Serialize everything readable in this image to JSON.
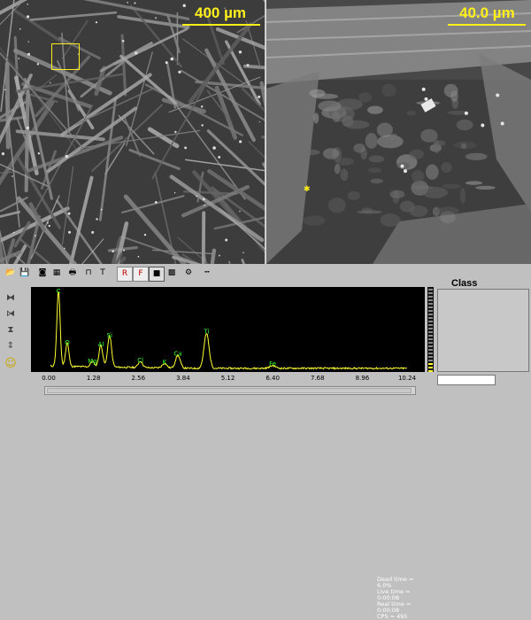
{
  "images": {
    "left": {
      "scale_label": "400 µm"
    },
    "right": {
      "scale_label": "40.0 µm"
    }
  },
  "toolbar": {
    "buttons": [
      {
        "name": "open-icon",
        "glyph": "📂"
      },
      {
        "name": "save-icon",
        "glyph": "💾"
      },
      {
        "name": "camera-icon",
        "glyph": "◙"
      },
      {
        "name": "print-preview-icon",
        "glyph": "▦"
      },
      {
        "name": "printer-icon",
        "glyph": "🖶"
      },
      {
        "name": "spectrum-icon",
        "glyph": "⊓"
      },
      {
        "name": "marker-icon",
        "glyph": "T"
      },
      {
        "name": "report-icon",
        "glyph": "R"
      },
      {
        "name": "filter-icon",
        "glyph": "F"
      },
      {
        "name": "stop-icon",
        "glyph": "■"
      },
      {
        "name": "map-icon",
        "glyph": "▩"
      },
      {
        "name": "settings-icon",
        "glyph": "⚙"
      },
      {
        "name": "ruler-icon",
        "glyph": "┅"
      }
    ]
  },
  "side_tools": [
    {
      "name": "zoom-x-in-icon",
      "glyph": "⧓"
    },
    {
      "name": "zoom-x-out-icon",
      "glyph": "⧒"
    },
    {
      "name": "zoom-y-in-icon",
      "glyph": "⧗"
    },
    {
      "name": "zoom-y-out-icon",
      "glyph": "⇕"
    },
    {
      "name": "smiley-icon",
      "glyph": "☺"
    }
  ],
  "status": {
    "dead_time": "Dead time = 6.0%",
    "live_time": "Live time = 0:00:08",
    "real_time": "Real time = 0:00:08",
    "cps": "CPS = 495"
  },
  "class_panel": {
    "title": "Class"
  },
  "colors": {
    "spectrum_line": "#ffff33",
    "peak_label": "#33ff33",
    "scale": "#ffef1a"
  },
  "chart_data": {
    "type": "line",
    "xlim": [
      0,
      10.24
    ],
    "ylim": [
      0,
      87
    ],
    "yticks": [
      "87",
      "65",
      "44",
      "22",
      "0"
    ],
    "xticks": [
      "0.00",
      "1.28",
      "2.56",
      "3.84",
      "5.12",
      "6.40",
      "7.68",
      "8.96",
      "10.24"
    ],
    "peaks": [
      {
        "label": "C",
        "x": 0.28,
        "y": 82
      },
      {
        "label": "O",
        "x": 0.53,
        "y": 26
      },
      {
        "label": "Mg",
        "x": 1.25,
        "y": 6
      },
      {
        "label": "Al",
        "x": 1.49,
        "y": 24
      },
      {
        "label": "Si",
        "x": 1.74,
        "y": 34
      },
      {
        "label": "Cl",
        "x": 2.62,
        "y": 7
      },
      {
        "label": "K",
        "x": 3.31,
        "y": 5
      },
      {
        "label": "Ca",
        "x": 3.69,
        "y": 14
      },
      {
        "label": "Ti",
        "x": 4.51,
        "y": 38
      },
      {
        "label": "Fe",
        "x": 6.4,
        "y": 3
      }
    ]
  }
}
